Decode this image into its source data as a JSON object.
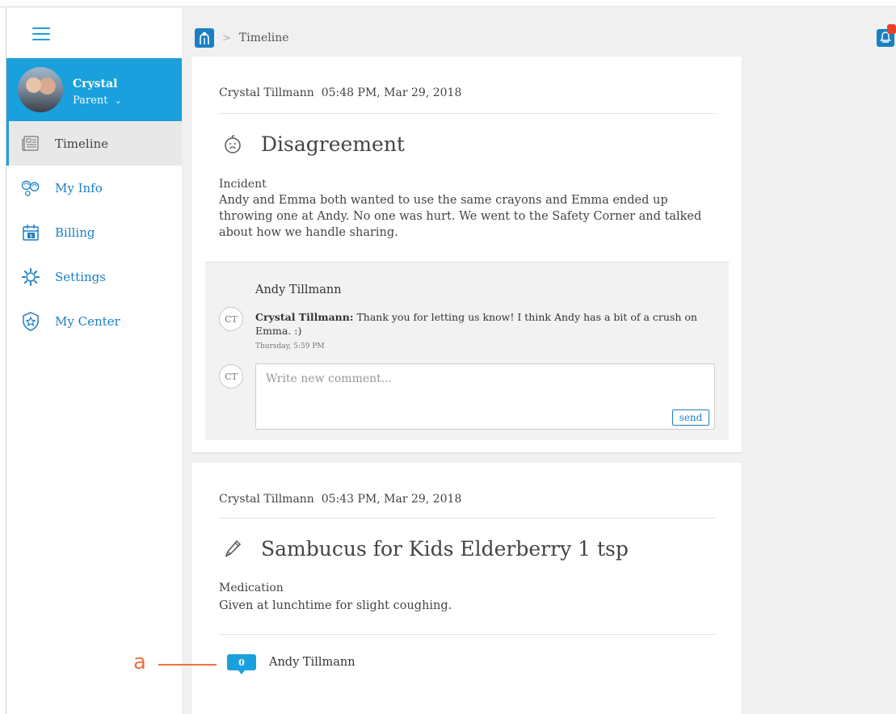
{
  "sidebar": {
    "menu_icon": "hamburger-menu-icon",
    "profile": {
      "name": "Crystal",
      "role": "Parent",
      "role_caret": "⌄"
    },
    "items": [
      {
        "label": "Timeline",
        "icon": "newspaper-icon",
        "active": true
      },
      {
        "label": "My Info",
        "icon": "people-icon",
        "active": false
      },
      {
        "label": "Billing",
        "icon": "calendar-dollar-icon",
        "active": false
      },
      {
        "label": "Settings",
        "icon": "gear-icon",
        "active": false
      },
      {
        "label": "My Center",
        "icon": "star-badge-icon",
        "active": false
      }
    ]
  },
  "breadcrumb": {
    "home_icon": "app-home-icon",
    "separator": ">",
    "current": "Timeline"
  },
  "notifications": {
    "icon": "bell-icon",
    "badge_color": "#e8412c"
  },
  "posts": [
    {
      "author": "Crystal Tillmann",
      "timestamp": "05:48 PM, Mar 29, 2018",
      "icon": "face-icon",
      "title": "Disagreement",
      "category": "Incident",
      "description": "Andy and Emma both wanted to use the same crayons and Emma ended up throwing one at Andy. No one was hurt. We went to the Safety Corner and talked about how we handle sharing.",
      "comments_section": {
        "child": "Andy Tillmann",
        "comments": [
          {
            "initials": "CT",
            "author": "Crystal Tillmann:",
            "text": "Thank you for letting us know! I think Andy has a bit of a crush on Emma. :)",
            "time": "Thursday, 5:59 PM"
          }
        ],
        "new_comment": {
          "initials": "CT",
          "placeholder": "Write new comment...",
          "send_label": "send"
        }
      }
    },
    {
      "author": "Crystal Tillmann",
      "timestamp": "05:43 PM, Mar 29, 2018",
      "icon": "pen-icon",
      "title": "Sambucus for Kids Elderberry 1 tsp",
      "category": "Medication",
      "description": "Given at lunchtime for slight coughing.",
      "comment_count": "0",
      "child": "Andy Tillmann"
    }
  ],
  "annotation": {
    "label": "a"
  },
  "colors": {
    "accent": "#1aa0dc",
    "link": "#1a7fc4",
    "annotation": "#e8743b"
  }
}
